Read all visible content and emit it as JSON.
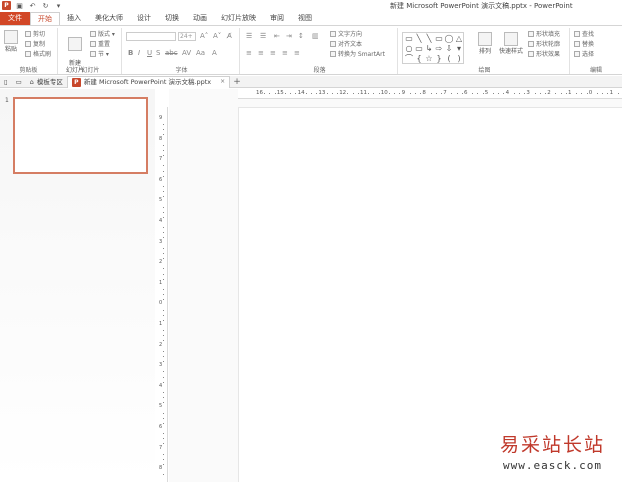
{
  "title_bar": {
    "window_title": "新建 Microsoft PowerPoint 演示文稿.pptx - PowerPoint",
    "qat_icons": [
      "powerpoint-logo",
      "save-icon",
      "undo-icon",
      "redo-icon",
      "customize-icon"
    ]
  },
  "ribbon_tabs": [
    "文件",
    "开始",
    "插入",
    "美化大师",
    "设计",
    "切换",
    "动画",
    "幻灯片放映",
    "审阅",
    "视图"
  ],
  "active_tab": "开始",
  "groups": {
    "clipboard": {
      "label": "剪贴板",
      "paste": "粘贴",
      "cut": "剪切",
      "copy": "复制",
      "format_painter": "格式刷"
    },
    "slides": {
      "label": "幻灯片",
      "new_slide": "新建\n幻灯片",
      "layout": "版式",
      "reset": "重置",
      "section": "节"
    },
    "font": {
      "label": "字体",
      "size": "24+"
    },
    "paragraph": {
      "label": "段落",
      "text_direction": "文字方向",
      "align_text": "对齐文本",
      "smartart": "转换为 SmartArt"
    },
    "drawing": {
      "label": "绘图",
      "arrange": "排列",
      "quick_styles": "快速样式",
      "fill": "形状填充",
      "outline": "形状轮廓",
      "effects": "形状效果"
    },
    "editing": {
      "label": "编辑",
      "find": "查找",
      "replace": "替换",
      "select": "选择"
    }
  },
  "doc_tabs": {
    "template_zone": "模板专区",
    "current_file": "新建 Microsoft PowerPoint 演示文稿.pptx",
    "close": "×",
    "add": "+"
  },
  "slide_panel": {
    "slide_number": "1"
  },
  "hruler_labels": [
    "16",
    "15",
    "14",
    "13",
    "12",
    "11",
    "10",
    "9",
    "8",
    "7",
    "6",
    "5",
    "4",
    "3",
    "2",
    "1",
    "0",
    "1"
  ],
  "vruler_labels": [
    "9",
    "8",
    "7",
    "6",
    "5",
    "4",
    "3",
    "2",
    "1",
    "0",
    "1",
    "2",
    "3",
    "4",
    "5",
    "6",
    "7",
    "8",
    "9"
  ],
  "watermark": {
    "cn": "易采站长站",
    "url": "www.easck.com"
  },
  "colors": {
    "accent": "#d24726",
    "selection": "#d57d63"
  }
}
